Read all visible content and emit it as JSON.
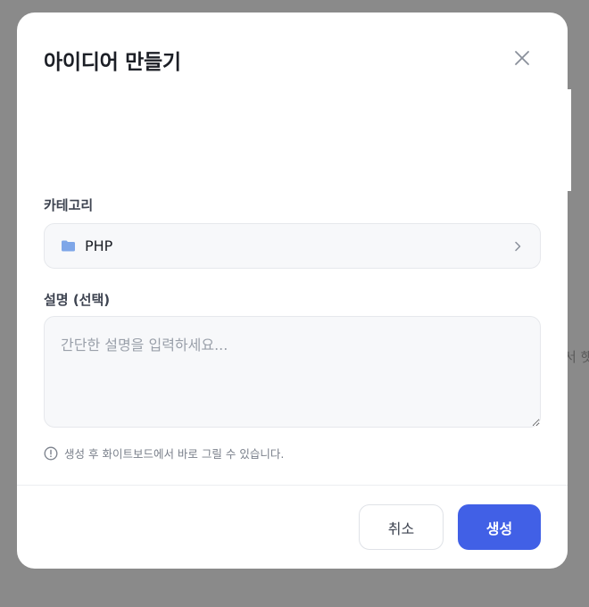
{
  "background": {
    "partial_text": "서 햇"
  },
  "modal": {
    "title": "아이디어 만들기",
    "category": {
      "label": "카테고리",
      "value": "PHP",
      "icon": "folder-icon"
    },
    "description": {
      "label": "설명 (선택)",
      "value": "",
      "placeholder": "간단한 설명을 입력하세요..."
    },
    "hint": "생성 후 화이트보드에서 바로 그릴 수 있습니다.",
    "buttons": {
      "cancel_label": "취소",
      "create_label": "생성"
    }
  },
  "colors": {
    "primary": "#4160e6",
    "folder": "#7ea6e8",
    "overlay": "#8a8a8a"
  }
}
